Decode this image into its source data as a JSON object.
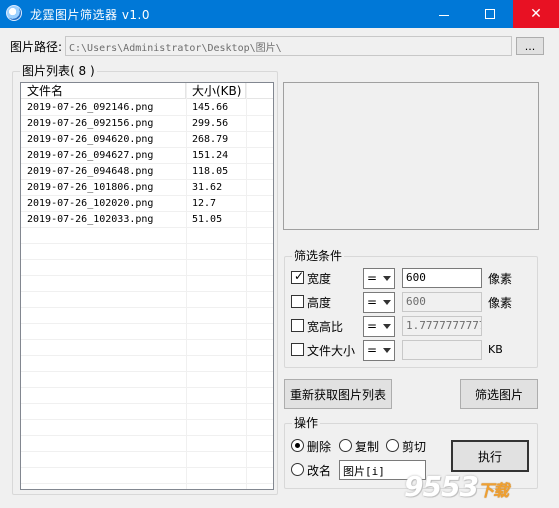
{
  "window": {
    "title": "龙霆图片筛选器 v1.0",
    "icon": "magnifier-icon",
    "controls": {
      "minimize": "minimize-icon",
      "maximize": "maximize-icon",
      "close": "close-icon",
      "close_glyph": "✕"
    }
  },
  "path_row": {
    "label": "图片路径:",
    "value": "C:\\Users\\Administrator\\Desktop\\图片\\",
    "browse_label": "..."
  },
  "image_list": {
    "group_title": "图片列表( 8 )",
    "columns": [
      "文件名",
      "大小(KB)"
    ],
    "rows": [
      [
        "2019-07-26_092146.png",
        "145.66"
      ],
      [
        "2019-07-26_092156.png",
        "299.56"
      ],
      [
        "2019-07-26_094620.png",
        "268.79"
      ],
      [
        "2019-07-26_094627.png",
        "151.24"
      ],
      [
        "2019-07-26_094648.png",
        "118.05"
      ],
      [
        "2019-07-26_101806.png",
        "31.62"
      ],
      [
        "2019-07-26_102020.png",
        "12.7"
      ],
      [
        "2019-07-26_102033.png",
        "51.05"
      ]
    ]
  },
  "filter": {
    "group_title": "筛选条件",
    "conditions": [
      {
        "label": "宽度",
        "checked": true,
        "operator": "=",
        "value": "600",
        "unit": "像素",
        "enabled": true
      },
      {
        "label": "高度",
        "checked": false,
        "operator": "=",
        "value": "600",
        "unit": "像素",
        "enabled": false
      },
      {
        "label": "宽高比",
        "checked": false,
        "operator": "=",
        "value": "1.7777777777",
        "unit": "",
        "enabled": false
      },
      {
        "label": "文件大小",
        "checked": false,
        "operator": "=",
        "value": "",
        "unit": "KB",
        "enabled": false
      }
    ],
    "check_glyph": "✓"
  },
  "buttons": {
    "refresh": "重新获取图片列表",
    "filter": "筛选图片",
    "execute": "执行"
  },
  "operation": {
    "group_title": "操作",
    "options": [
      {
        "label": "删除",
        "selected": true
      },
      {
        "label": "复制",
        "selected": false
      },
      {
        "label": "剪切",
        "selected": false
      },
      {
        "label": "改名",
        "selected": false
      }
    ],
    "rename_pattern": "图片[i]"
  },
  "watermark": {
    "main": "9553",
    "suffix": "下载"
  },
  "colors": {
    "titlebar": "#0078d7",
    "close_button": "#e81123"
  }
}
